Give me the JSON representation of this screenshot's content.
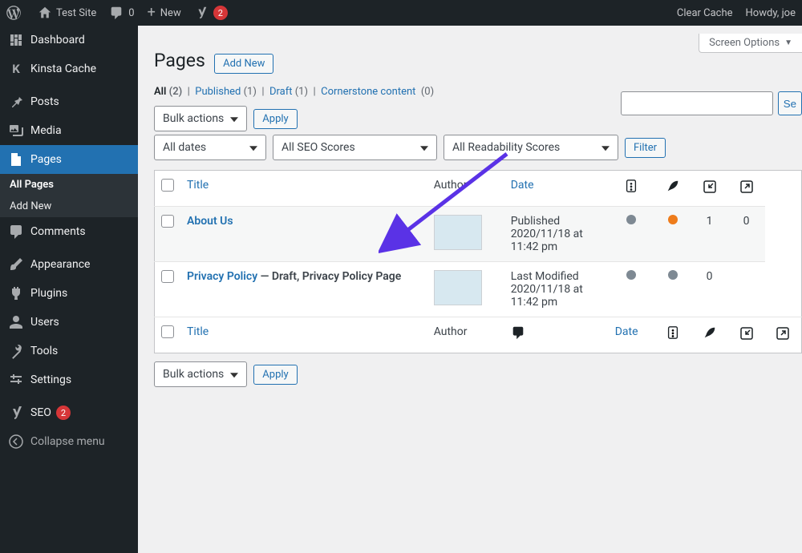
{
  "adminbar": {
    "site_name": "Test Site",
    "comments_count": "0",
    "new_label": "New",
    "yoast_badge": "2",
    "clear_cache": "Clear Cache",
    "howdy": "Howdy, joe"
  },
  "sidebar": {
    "dashboard": "Dashboard",
    "kinsta": "Kinsta Cache",
    "posts": "Posts",
    "media": "Media",
    "pages": "Pages",
    "pages_sub_all": "All Pages",
    "pages_sub_new": "Add New",
    "comments": "Comments",
    "appearance": "Appearance",
    "plugins": "Plugins",
    "users": "Users",
    "tools": "Tools",
    "settings": "Settings",
    "seo": "SEO",
    "seo_badge": "2",
    "collapse": "Collapse menu"
  },
  "header": {
    "title": "Pages",
    "add_new": "Add New",
    "screen_options": "Screen Options"
  },
  "views": {
    "all_label": "All",
    "all_count": "(2)",
    "published_label": "Published",
    "published_count": "(1)",
    "draft_label": "Draft",
    "draft_count": "(1)",
    "cornerstone_label": "Cornerstone content",
    "cornerstone_count": "(0)"
  },
  "filters": {
    "bulk_actions": "Bulk actions",
    "apply": "Apply",
    "all_dates": "All dates",
    "all_seo_scores": "All SEO Scores",
    "all_readability": "All Readability Scores",
    "filter_btn": "Filter"
  },
  "search": {
    "button": "Se"
  },
  "columns": {
    "title": "Title",
    "author": "Author",
    "date": "Date"
  },
  "rows": [
    {
      "title": "About Us",
      "state": "",
      "status_line1": "Published",
      "status_line2": "2020/11/18 at 11:42 pm",
      "incoming": "1",
      "outgoing": "0",
      "readability": "gray",
      "seo": "orange"
    },
    {
      "title": "Privacy Policy",
      "state": " — Draft, Privacy Policy Page",
      "status_line1": "Last Modified",
      "status_line2": "2020/11/18 at 11:42 pm",
      "incoming": "0",
      "outgoing": "",
      "readability": "gray",
      "seo": "gray"
    }
  ],
  "footer_date": "Date"
}
